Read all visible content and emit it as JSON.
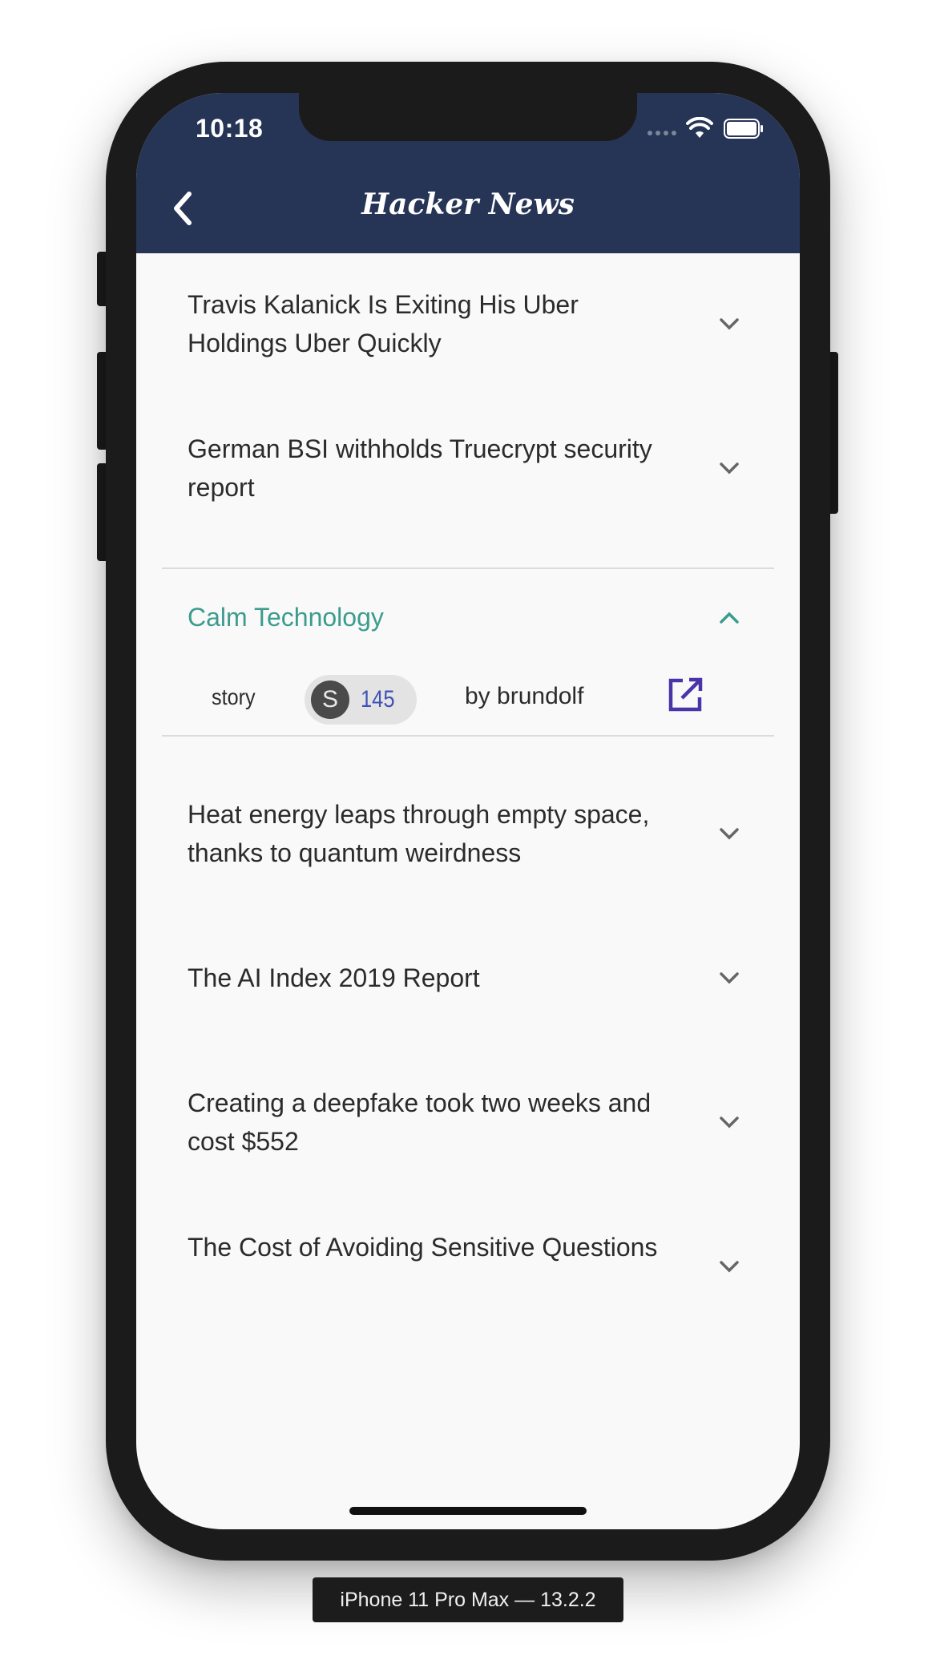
{
  "status_bar": {
    "time": "10:18"
  },
  "app_bar": {
    "title": "Hacker News",
    "back_icon": "chevron-left-icon"
  },
  "stories": [
    {
      "title": "Travis Kalanick Is Exiting His Uber Holdings Uber Quickly",
      "expanded": false
    },
    {
      "title": "German BSI withholds Truecrypt security report",
      "expanded": false
    },
    {
      "title": "Calm Technology",
      "expanded": true
    },
    {
      "title": "Heat energy leaps through empty space, thanks to quantum weirdness",
      "expanded": false
    },
    {
      "title": "The AI Index 2019 Report",
      "expanded": false
    },
    {
      "title": "Creating a deepfake took two weeks and cost $552",
      "expanded": false
    },
    {
      "title": "The Cost of Avoiding Sensitive Questions",
      "expanded": false
    }
  ],
  "expanded_details": {
    "type": "story",
    "score_avatar": "S",
    "score": "145",
    "author": "by brundolf",
    "open_icon": "open-in-new-icon"
  },
  "device_label": "iPhone 11 Pro Max — 13.2.2",
  "colors": {
    "app_bar": "#263455",
    "accent_expanded": "#3b9c8e",
    "score": "#3f51b5",
    "open_link": "#4a35a8"
  }
}
